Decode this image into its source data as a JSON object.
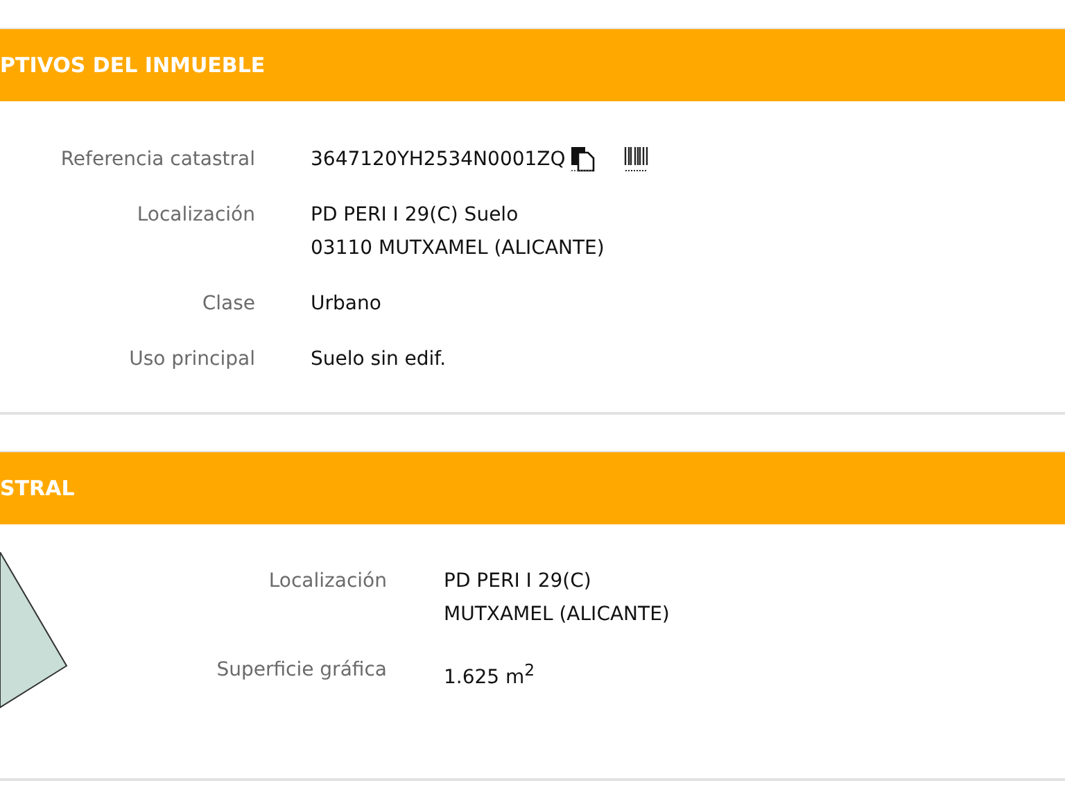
{
  "sections": [
    {
      "title": "PTIVOS DEL INMUEBLE",
      "parcel_drawing": false,
      "rows": [
        {
          "label": "Referencia catastral",
          "lines": [
            "3647120YH2534N0001ZQ"
          ],
          "icons": [
            {
              "kind": "copy"
            },
            {
              "kind": "barcode"
            }
          ]
        },
        {
          "label": "Localización",
          "lines": [
            "PD PERI I 29(C) Suelo",
            "03110 MUTXAMEL (ALICANTE)"
          ]
        },
        {
          "label": "Clase",
          "lines": [
            "Urbano"
          ]
        },
        {
          "label": "Uso principal",
          "lines": [
            "Suelo sin edif."
          ]
        }
      ]
    },
    {
      "title": "STRAL",
      "parcel_drawing": true,
      "rows": [
        {
          "label": "Localización",
          "lines": [
            "PD PERI I 29(C)",
            "MUTXAMEL (ALICANTE)"
          ]
        },
        {
          "label": "Superficie gráfica",
          "lines": [
            "1.625 m$^{2}$"
          ]
        }
      ]
    }
  ]
}
